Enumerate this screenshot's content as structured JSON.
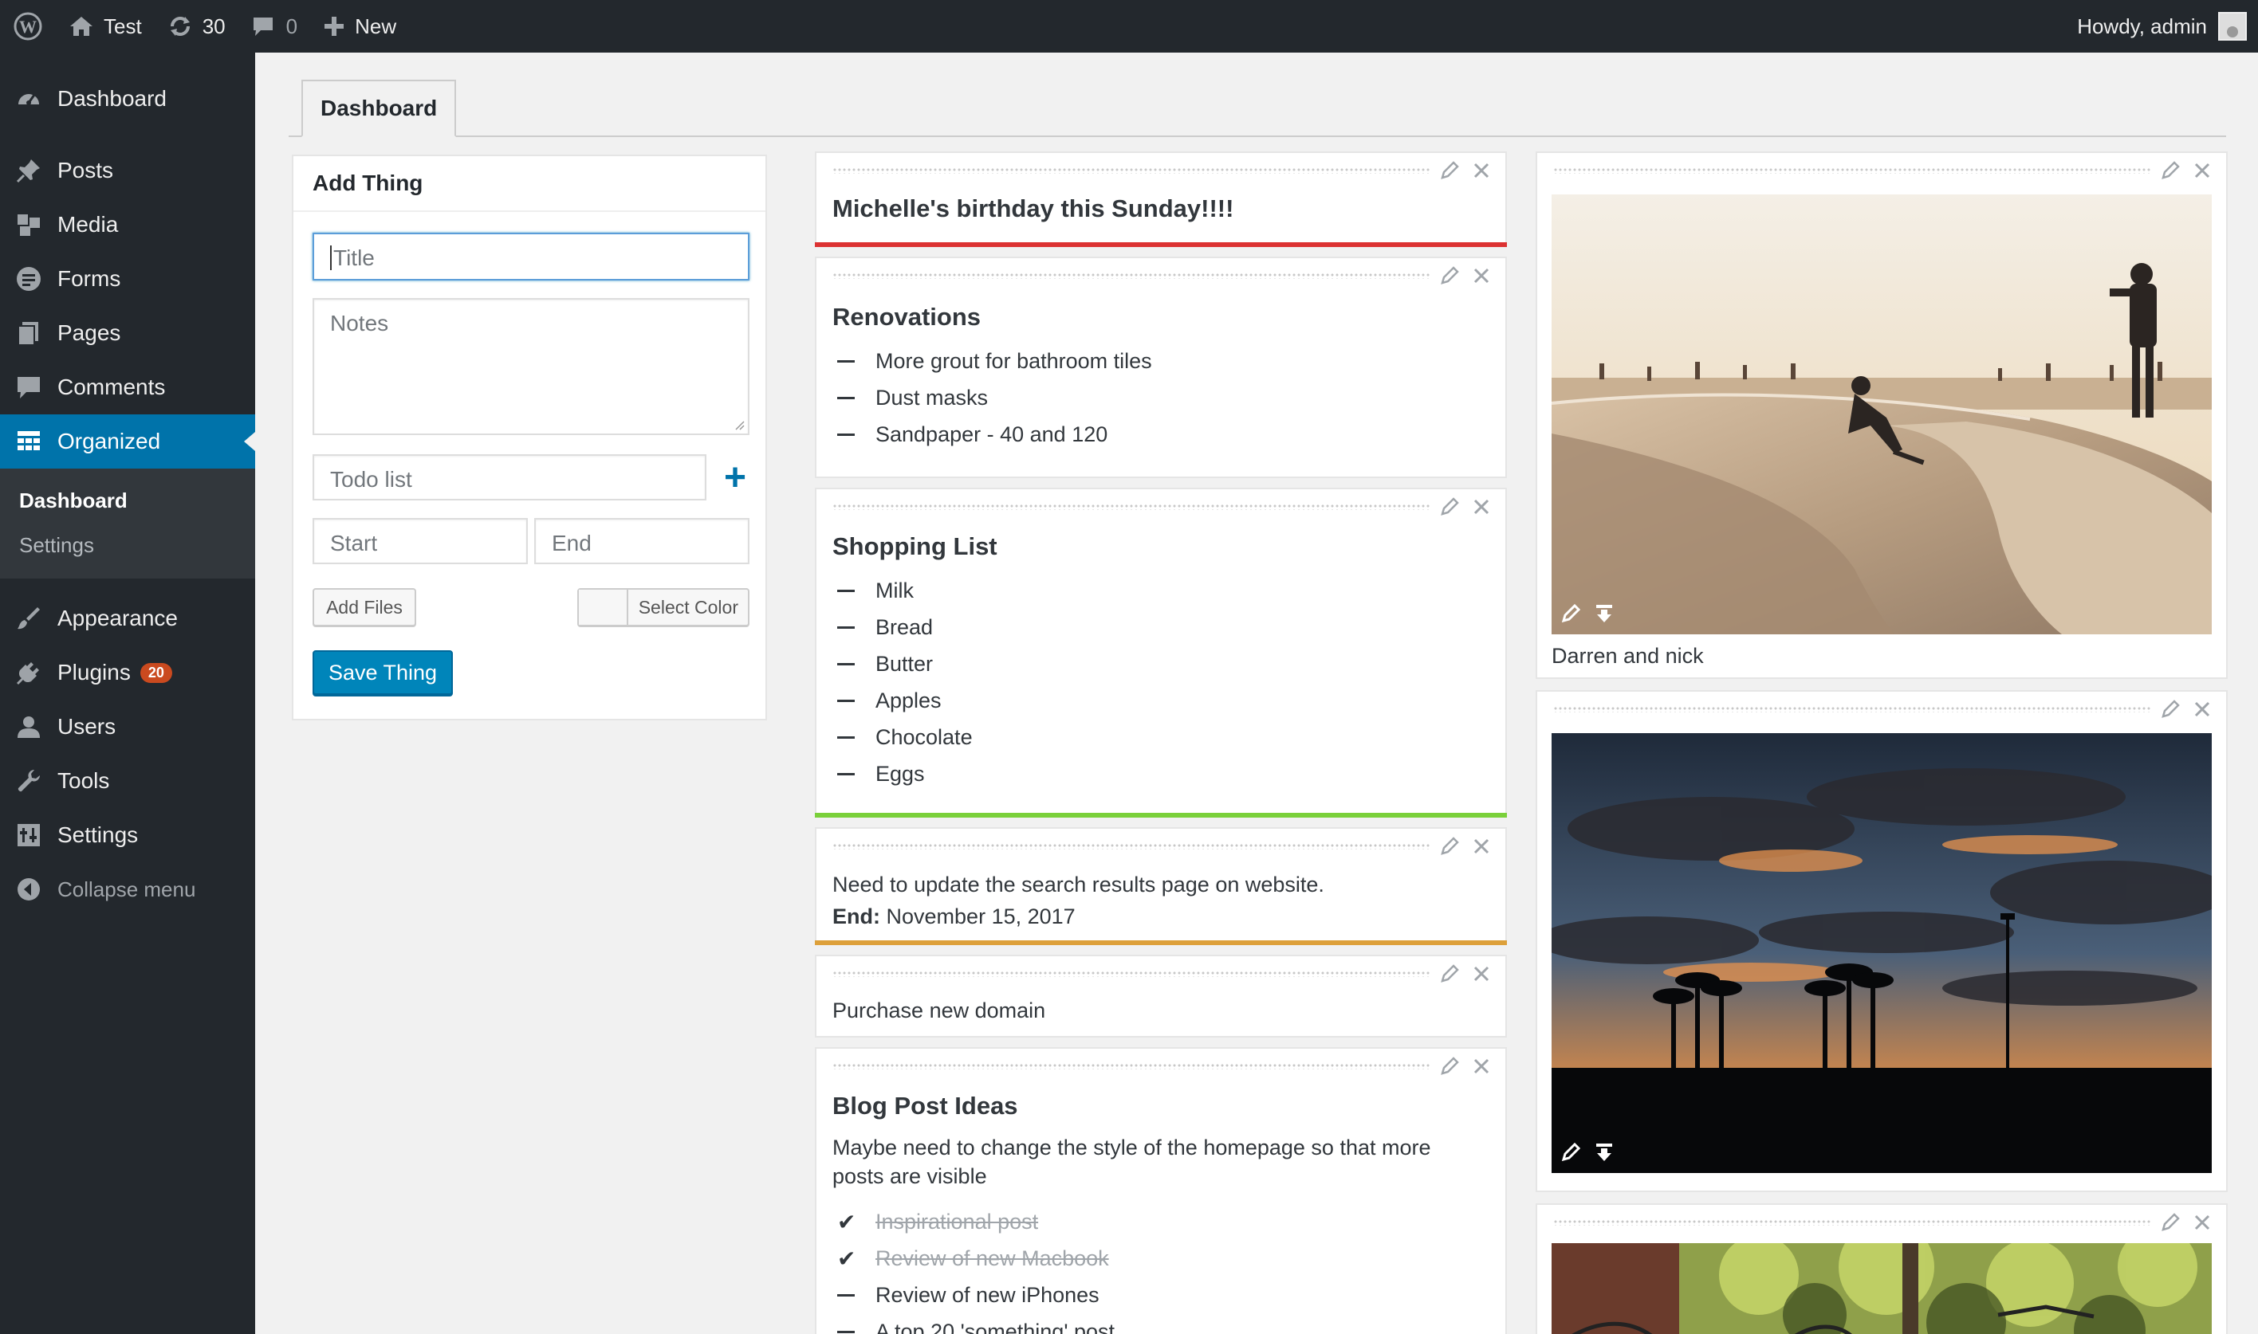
{
  "adminbar": {
    "site_name": "Test",
    "updates_count": "30",
    "comments_count": "0",
    "new_label": "New",
    "howdy": "Howdy, admin"
  },
  "sidebar": {
    "items": [
      {
        "label": "Dashboard",
        "icon": "dashboard-icon"
      },
      {
        "label": "Posts",
        "icon": "pin-icon"
      },
      {
        "label": "Media",
        "icon": "media-icon"
      },
      {
        "label": "Forms",
        "icon": "forms-icon"
      },
      {
        "label": "Pages",
        "icon": "pages-icon"
      },
      {
        "label": "Comments",
        "icon": "comment-icon"
      },
      {
        "label": "Organized",
        "icon": "grid-icon"
      }
    ],
    "submenu": [
      "Dashboard",
      "Settings"
    ],
    "items2": [
      {
        "label": "Appearance",
        "icon": "brush-icon"
      },
      {
        "label": "Plugins",
        "icon": "plug-icon",
        "badge": "20"
      },
      {
        "label": "Users",
        "icon": "user-icon"
      },
      {
        "label": "Tools",
        "icon": "wrench-icon"
      },
      {
        "label": "Settings",
        "icon": "settings-icon"
      }
    ],
    "collapse_label": "Collapse menu"
  },
  "tabs": {
    "active": "Dashboard"
  },
  "add_thing": {
    "title": "Add Thing",
    "title_placeholder": "Title",
    "notes_placeholder": "Notes",
    "todo_placeholder": "Todo list",
    "start_placeholder": "Start",
    "end_placeholder": "End",
    "add_files_label": "Add Files",
    "select_color_label": "Select Color",
    "save_label": "Save Thing"
  },
  "notes": {
    "birthday": {
      "title": "Michelle's birthday this Sunday!!!!",
      "color": "#dc3232"
    },
    "renovations": {
      "title": "Renovations",
      "items": [
        "More grout for bathroom tiles",
        "Dust masks",
        "Sandpaper - 40 and 120"
      ]
    },
    "shopping": {
      "title": "Shopping List",
      "items": [
        "Milk",
        "Bread",
        "Butter",
        "Apples",
        "Chocolate",
        "Eggs"
      ],
      "color": "#7ad03a"
    },
    "website": {
      "text": "Need to update the search results page on website.",
      "end_label": "End:",
      "end_date": "November 15, 2017",
      "color": "#dda03a"
    },
    "domain": {
      "text": "Purchase new domain"
    },
    "blog": {
      "title": "Blog Post Ideas",
      "text": "Maybe need to change the style of the homepage so that more posts are visible",
      "items": [
        "Inspirational post",
        "Review of new Macbook",
        "Review of new iPhones",
        "A top 20 'something' post"
      ]
    }
  },
  "photos": {
    "first_caption": "Darren and nick"
  }
}
